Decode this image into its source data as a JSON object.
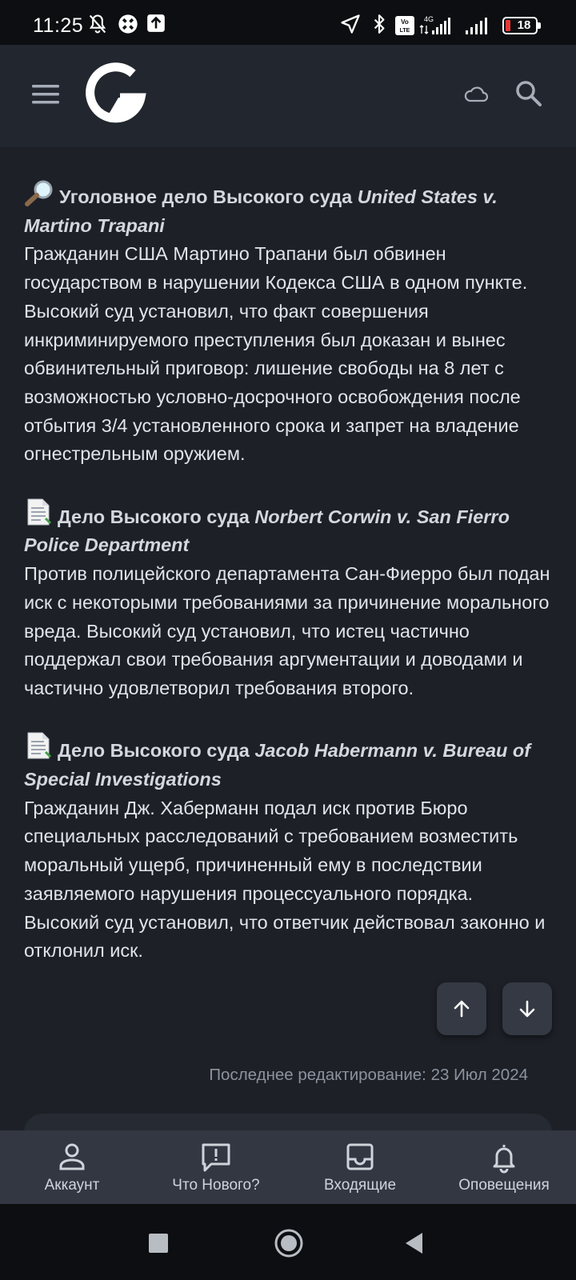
{
  "status_bar": {
    "time": "11:25",
    "battery": "18",
    "network": "4G",
    "volte": "Vo LTE"
  },
  "app_bar": {
    "logo": "G",
    "icons": [
      "menu-icon",
      "cloud-icon",
      "search-icon"
    ]
  },
  "post": {
    "items": [
      {
        "emoji": "magnifier",
        "title_prefix": "Уголовное дело Высокого суда ",
        "title_case": "United States v. Martino Trapani",
        "body": "Гражданин США Мартино Трапани был обвинен государством в нарушении Кодекса США в одном пункте. Высокий суд установил, что факт совершения инкриминируемого преступления был доказан и вынес обвинительный приговор: лишение свободы на 8 лет с возможностью условно-досрочного освобождения после отбытия 3/4 установленного срока и запрет на владение огнестрельным оружием."
      },
      {
        "emoji": "document",
        "title_prefix": "Дело Высокого суда ",
        "title_case": "Norbert Corwin v. San Fierro Police Department",
        "body": "Против полицейского департамента Сан-Фиерро был подан иск с некоторыми требованиями за причинение морального вреда. Высокий суд установил, что истец частично поддержал свои требования аргументации и доводами и частично удовлетворил требования второго."
      },
      {
        "emoji": "document",
        "title_prefix": "Дело Высокого суда ",
        "title_case": "Jacob Habermann v. Bureau of Special Investigations",
        "body": "Гражданин Дж. Хаберманн подал иск против Бюро специальных расследований с требованием возместить моральный ущерб, причиненный ему в последствии заявляемого нарушения процессуального порядка. Высокий суд установил, что ответчик действовал законно и отклонил иск."
      }
    ],
    "last_edited": "Последнее редактирование: 23 Июл 2024"
  },
  "scroll_buttons": [
    "arrow-up-icon",
    "arrow-down-icon"
  ],
  "tab_bar": {
    "tabs": [
      {
        "label": "Аккаунт",
        "icon": "account-icon"
      },
      {
        "label": "Что Нового?",
        "icon": "whats-new-icon"
      },
      {
        "label": "Входящие",
        "icon": "inbox-icon"
      },
      {
        "label": "Оповещения",
        "icon": "bell-icon"
      }
    ]
  },
  "system_nav": [
    "recents-square-icon",
    "home-circle-icon",
    "back-triangle-icon"
  ]
}
